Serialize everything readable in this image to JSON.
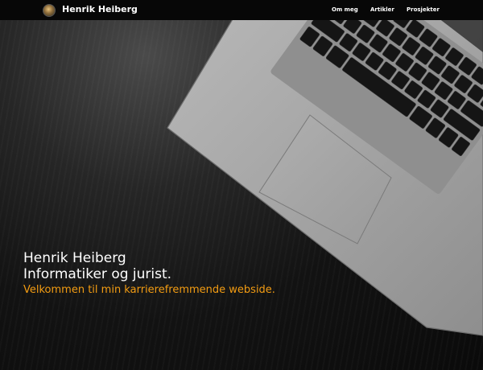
{
  "brand": {
    "name": "Henrik Heiberg",
    "avatar_icon": "profile-photo"
  },
  "nav": {
    "items": [
      {
        "label": "Om meg"
      },
      {
        "label": "Artikler"
      },
      {
        "label": "Prosjekter"
      }
    ]
  },
  "hero": {
    "name": "Henrik Heiberg",
    "role": "Informatiker og jurist.",
    "tagline": "Velkommen til min karrierefremmende webside.",
    "background_image": "laptop-on-dark-wood",
    "tagline_color": "#f39c12"
  }
}
